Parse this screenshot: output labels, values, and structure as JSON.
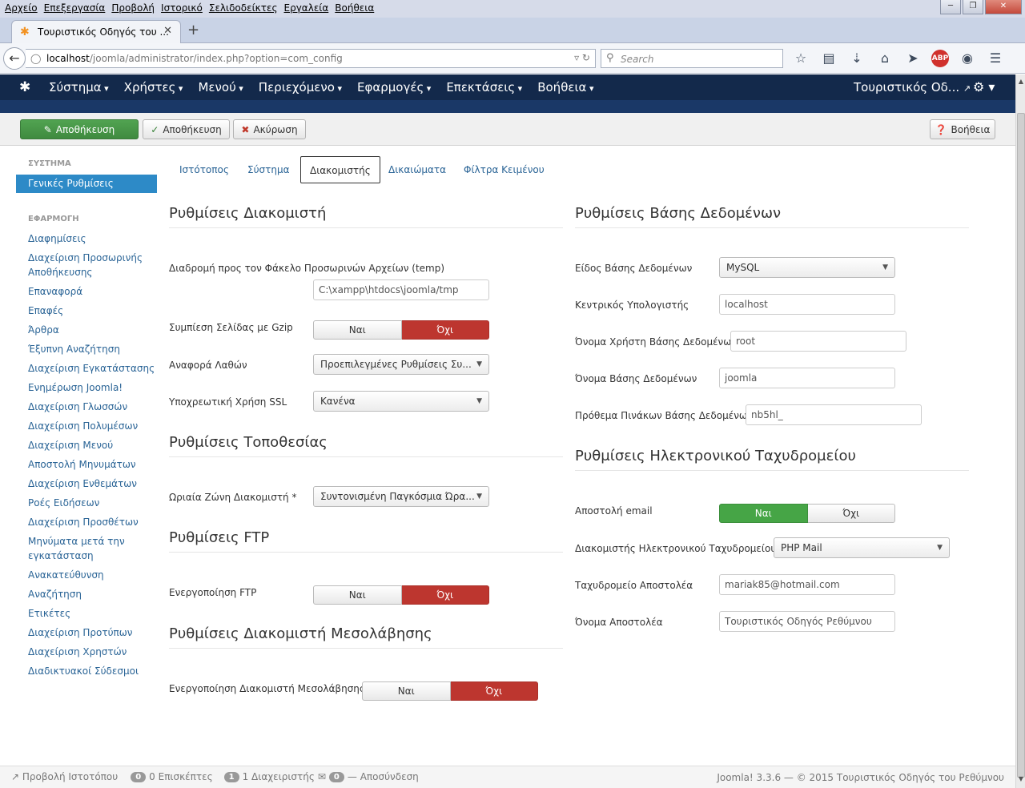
{
  "browser": {
    "menus": [
      "Αρχείο",
      "Επεξεργασία",
      "Προβολή",
      "Ιστορικό",
      "Σελιδοδείκτες",
      "Εργαλεία",
      "Βοήθεια"
    ],
    "tab_title": "Τουριστικός Οδηγός του ...",
    "url_host": "localhost",
    "url_path": "/joomla/administrator/index.php?option=com_config",
    "search_placeholder": "Search"
  },
  "joomla": {
    "menu": [
      "Σύστημα",
      "Χρήστες",
      "Μενού",
      "Περιεχόμενο",
      "Εφαρμογές",
      "Επεκτάσεις",
      "Βοήθεια"
    ],
    "site_link": "Τουριστικός Οδ...",
    "toolbar": {
      "save_close": "Αποθήκευση",
      "save": "Αποθήκευση",
      "cancel": "Ακύρωση",
      "help": "Βοήθεια"
    },
    "sidebar": {
      "system_heading": "ΣΥΣΤΗΜΑ",
      "active_item": "Γενικές Ρυθμίσεις",
      "app_heading": "ΕΦΑΡΜΟΓΗ",
      "items": [
        "Διαφημίσεις",
        "Διαχείριση Προσωρινής Αποθήκευσης",
        "Επαναφορά",
        "Επαφές",
        "Άρθρα",
        "Έξυπνη Αναζήτηση",
        "Διαχείριση Εγκατάστασης",
        "Ενημέρωση Joomla!",
        "Διαχείριση Γλωσσών",
        "Διαχείριση Πολυμέσων",
        "Διαχείριση Μενού",
        "Αποστολή Μηνυμάτων",
        "Διαχείριση Ενθεμάτων",
        "Ροές Ειδήσεων",
        "Διαχείριση Προσθέτων",
        "Μηνύματα μετά την εγκατάσταση",
        "Ανακατεύθυνση",
        "Αναζήτηση",
        "Ετικέτες",
        "Διαχείριση Προτύπων",
        "Διαχείριση Χρηστών",
        "Διαδικτυακοί Σύδεσμοι"
      ]
    },
    "tabs": [
      "Ιστότοπος",
      "Σύστημα",
      "Διακομιστής",
      "Δικαιώματα",
      "Φίλτρα Κειμένου"
    ],
    "server": {
      "title": "Ρυθμίσεις Διακομιστή",
      "temp_label": "Διαδρομή προς τον Φάκελο Προσωρινών Αρχείων (temp)",
      "temp_value": "C:\\xampp\\htdocs\\joomla/tmp",
      "gzip_label": "Συμπίεση Σελίδας με Gzip",
      "error_label": "Αναφορά Λαθών",
      "error_value": "Προεπιλεγμένες Ρυθμίσεις Συ...",
      "ssl_label": "Υποχρεωτική Χρήση SSL",
      "ssl_value": "Κανένα"
    },
    "location": {
      "title": "Ρυθμίσεις Τοποθεσίας",
      "tz_label": "Ωριαία Ζώνη Διακομιστή *",
      "tz_value": "Συντονισμένη Παγκόσμια Ώρα..."
    },
    "ftp": {
      "title": "Ρυθμίσεις FTP",
      "enable_label": "Ενεργοποίηση FTP"
    },
    "proxy": {
      "title": "Ρυθμίσεις Διακομιστή Μεσολάβησης",
      "enable_label": "Ενεργοποίηση Διακομιστή Μεσολάβησης"
    },
    "database": {
      "title": "Ρυθμίσεις Βάσης Δεδομένων",
      "type_label": "Είδος Βάσης Δεδομένων",
      "type_value": "MySQL",
      "host_label": "Κεντρικός Υπολογιστής",
      "host_value": "localhost",
      "user_label": "Όνομα Χρήστη Βάσης Δεδομένων",
      "user_value": "root",
      "name_label": "Όνομα Βάσης Δεδομένων",
      "name_value": "joomla",
      "prefix_label": "Πρόθεμα Πινάκων Βάσης Δεδομένων",
      "prefix_value": "nb5hl_"
    },
    "mail": {
      "title": "Ρυθμίσεις Ηλεκτρονικού Ταχυδρομείου",
      "send_label": "Αποστολή email",
      "mailer_label": "Διακομιστής Ηλεκτρονικού Ταχυδρομείου *",
      "mailer_value": "PHP Mail",
      "from_label": "Ταχυδρομείο Αποστολέα",
      "from_value": "mariak85@hotmail.com",
      "fromname_label": "Όνομα Αποστολέα",
      "fromname_value": "Τουριστικός Οδηγός Ρεθύμνου"
    },
    "toggle": {
      "yes": "Ναι",
      "no": "Όχι"
    },
    "status": {
      "view_site": "Προβολή Ιστοτόπου",
      "visitors_count": "0",
      "visitors_label": "0 Επισκέπτες",
      "admins_count": "1",
      "admins_label": "1 Διαχειριστής",
      "messages_count": "0",
      "logout": "Αποσύνδεση",
      "footer": "Joomla! 3.3.6 — © 2015 Τουριστικός Οδηγός του Ρεθύμνου"
    }
  },
  "colors": {
    "joomla_nav": "#13294b",
    "active_blue": "#2d8ac7",
    "toggle_red": "#bd362f",
    "toggle_green": "#46a546",
    "save_green": "#51a351"
  }
}
